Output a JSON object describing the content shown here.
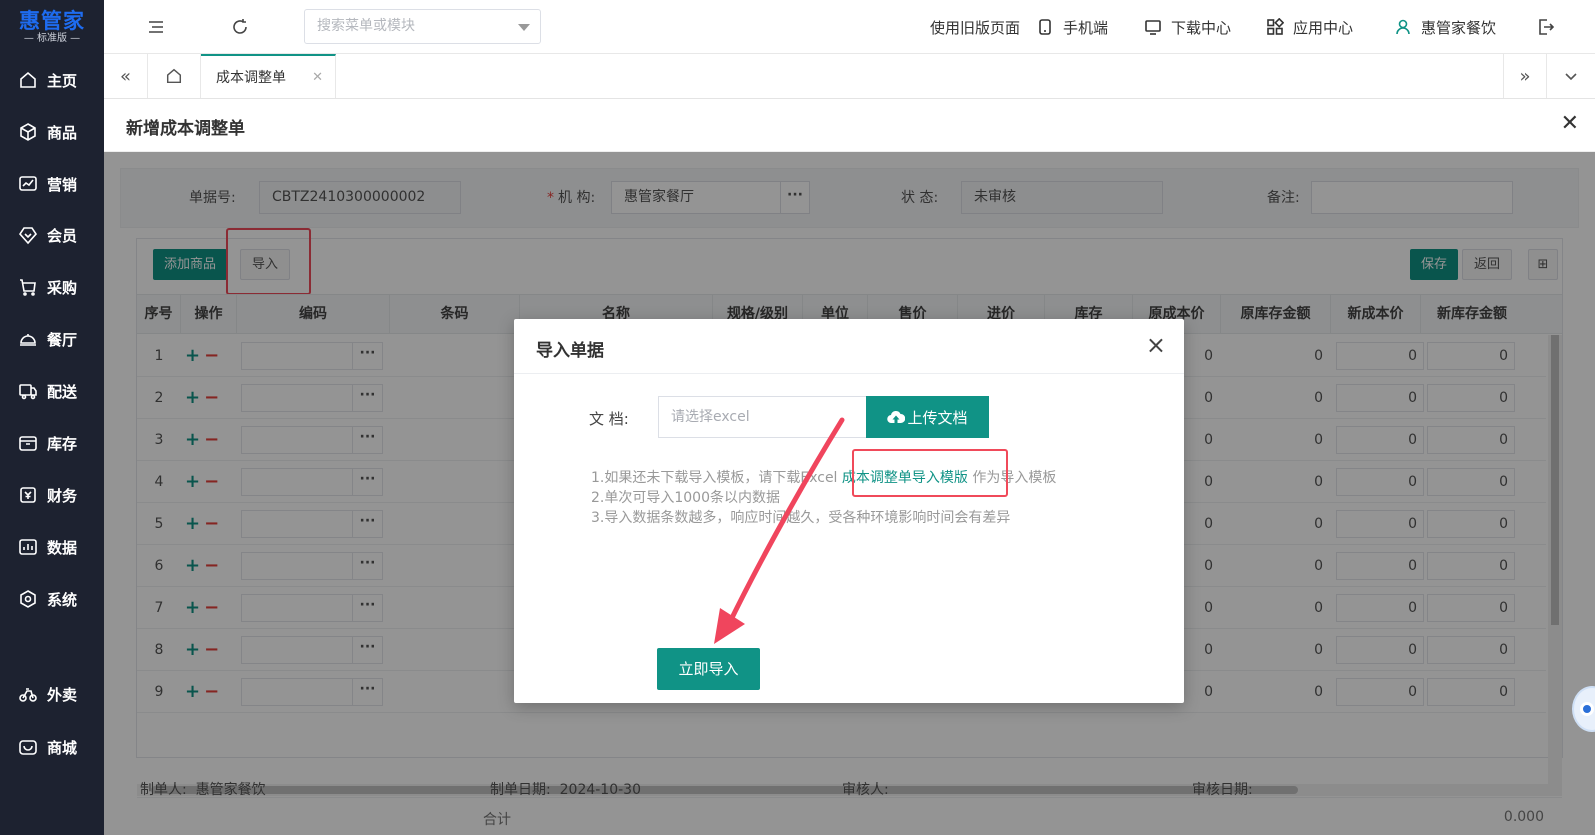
{
  "brand": {
    "name": "惠管家",
    "edition": "— 标准版 —"
  },
  "sidebar": {
    "items": [
      {
        "label": "主页",
        "icon": "home-icon"
      },
      {
        "label": "商品",
        "icon": "box-icon"
      },
      {
        "label": "营销",
        "icon": "chart-icon"
      },
      {
        "label": "会员",
        "icon": "diamond-icon"
      },
      {
        "label": "采购",
        "icon": "cart-icon"
      },
      {
        "label": "餐厅",
        "icon": "dish-icon"
      },
      {
        "label": "配送",
        "icon": "truck-icon"
      },
      {
        "label": "库存",
        "icon": "inventory-icon"
      },
      {
        "label": "财务",
        "icon": "finance-icon"
      },
      {
        "label": "数据",
        "icon": "data-icon"
      },
      {
        "label": "系统",
        "icon": "settings-icon"
      },
      {
        "label": "外卖",
        "icon": "bike-icon"
      },
      {
        "label": "商城",
        "icon": "shop-icon"
      }
    ]
  },
  "topbar": {
    "search_placeholder": "搜索菜单或模块",
    "links": {
      "old_page": "使用旧版页面",
      "mobile": "手机端",
      "download": "下载中心",
      "apps": "应用中心",
      "user": "惠管家餐饮"
    }
  },
  "tabs": {
    "active": "成本调整单"
  },
  "page": {
    "title": "新增成本调整单",
    "form": {
      "doc_no_label": "单据号:",
      "doc_no": "CBTZ2410300000002",
      "org_label": "机 构:",
      "org": "惠管家餐厅",
      "status_label": "状 态:",
      "status": "未审核",
      "remark_label": "备注:"
    },
    "buttons": {
      "add_goods": "添加商品",
      "import": "导入",
      "save": "保存",
      "back": "返回"
    },
    "columns": [
      "序号",
      "操作",
      "编码",
      "条码",
      "名称",
      "规格/级别",
      "单位",
      "售价",
      "进价",
      "库存",
      "原成本价",
      "原库存金额",
      "新成本价",
      "新库存金额"
    ],
    "rows": [
      "1",
      "2",
      "3",
      "4",
      "5",
      "6",
      "7",
      "8",
      "9"
    ],
    "zero": "0",
    "total_label": "合计",
    "total_value": "0.000",
    "footer": {
      "creator_label": "制单人:",
      "creator": "惠管家餐饮",
      "date_label": "制单日期:",
      "date": "2024-10-30",
      "auditor_label": "审核人:",
      "audit_date_label": "审核日期:"
    }
  },
  "modal": {
    "title": "导入单据",
    "doc_label": "文 档:",
    "file_placeholder": "请选择excel",
    "upload_label": "上传文档",
    "note1_pre": "1.如果还未下载导入模板，请下载Excel",
    "note1_link": "成本调整单导入模版",
    "note1_post": "作为导入模板",
    "note2": "2.单次可导入1000条以内数据",
    "note3": "3.导入数据条数越多，响应时间越久，受各种环境影响时间会有差异",
    "import_now": "立即导入"
  },
  "colors": {
    "accent": "#109386",
    "sidebar_bg": "#1d2230",
    "highlight": "#f04a5a"
  }
}
